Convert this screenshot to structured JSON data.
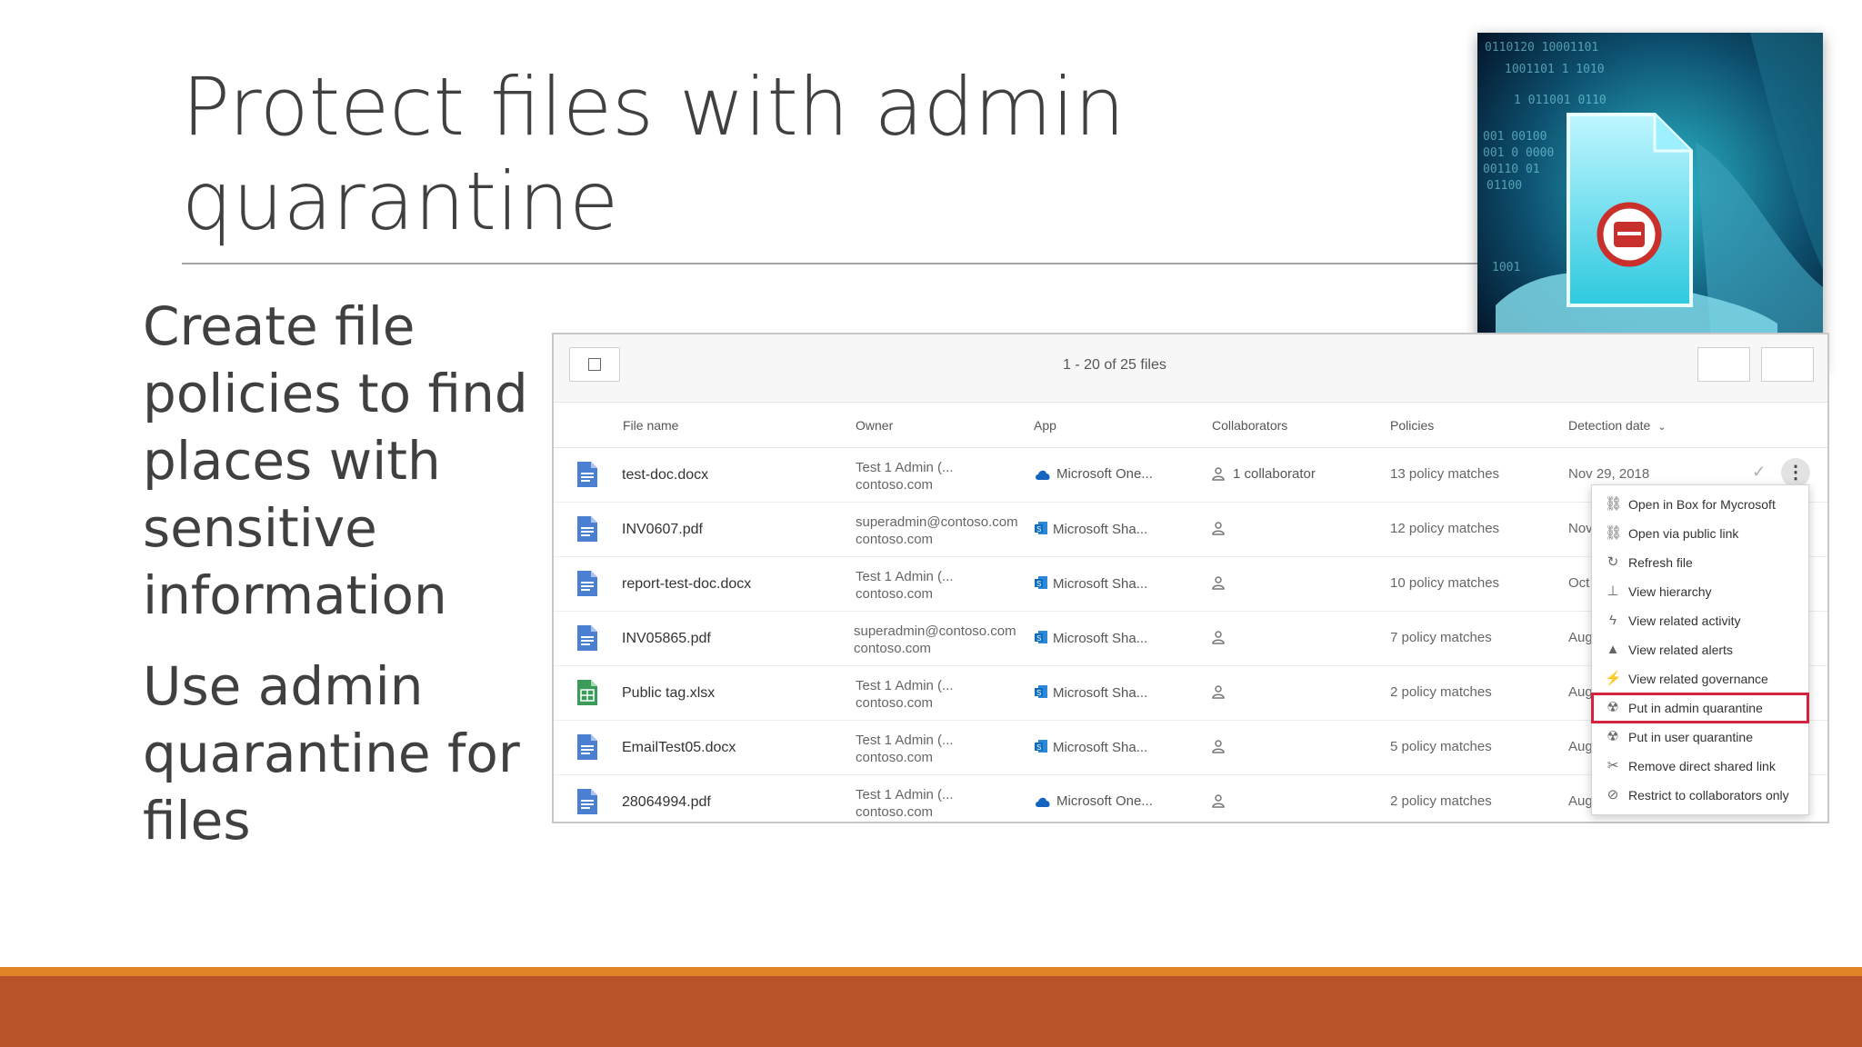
{
  "slide": {
    "title": "Protect files with admin quarantine",
    "bullets": [
      "Create file policies to find places with sensitive information",
      "Use admin quarantine for files"
    ]
  },
  "colors": {
    "accent_orange": "#e08428",
    "footer_rust": "#b8542a",
    "highlight_red": "#d3233d",
    "file_blue": "#4a7fd1",
    "file_green": "#3b9b5b"
  },
  "file_list": {
    "count_text": "1 - 20 of 25 files",
    "columns": [
      "File name",
      "Owner",
      "App",
      "Collaborators",
      "Policies",
      "Detection date"
    ],
    "rows": [
      {
        "name": "test-doc.docx",
        "icon": "doc-file-icon",
        "owner_line1": "Test 1 Admin (...",
        "owner_line2": "contoso.com",
        "app": "Microsoft One...",
        "app_icon": "onedrive-icon",
        "collaborators": "1 collaborator",
        "policies": "13 policy matches",
        "date": "Nov 29, 2018"
      },
      {
        "name": "INV0607.pdf",
        "icon": "doc-file-icon",
        "owner_line1": "superadmin@contoso.com",
        "owner_line2": "contoso.com",
        "app": "Microsoft Sha...",
        "app_icon": "sharepoint-icon",
        "collaborators": "",
        "policies": "12 policy matches",
        "date": "Nov"
      },
      {
        "name": "report-test-doc.docx",
        "icon": "doc-file-icon",
        "owner_line1": "Test 1 Admin (...",
        "owner_line2": "contoso.com",
        "app": "Microsoft Sha...",
        "app_icon": "sharepoint-icon",
        "collaborators": "",
        "policies": "10 policy matches",
        "date": "Oct"
      },
      {
        "name": "INV05865.pdf",
        "icon": "doc-file-icon",
        "owner_line1": "superadmin@contoso.com",
        "owner_line2": "contoso.com",
        "app": "Microsoft Sha...",
        "app_icon": "sharepoint-icon",
        "collaborators": "",
        "policies": "7 policy matches",
        "date": "Aug"
      },
      {
        "name": "Public tag.xlsx",
        "icon": "sheet-file-icon",
        "owner_line1": "Test 1 Admin (...",
        "owner_line2": "contoso.com",
        "app": "Microsoft Sha...",
        "app_icon": "sharepoint-icon",
        "collaborators": "",
        "policies": "2 policy matches",
        "date": "Aug"
      },
      {
        "name": "EmailTest05.docx",
        "icon": "doc-file-icon",
        "owner_line1": "Test 1 Admin (...",
        "owner_line2": "contoso.com",
        "app": "Microsoft Sha...",
        "app_icon": "sharepoint-icon",
        "collaborators": "",
        "policies": "5 policy matches",
        "date": "Aug"
      },
      {
        "name": "28064994.pdf",
        "icon": "doc-file-icon",
        "owner_line1": "Test 1 Admin (...",
        "owner_line2": "contoso.com",
        "app": "Microsoft One...",
        "app_icon": "onedrive-icon",
        "collaborators": "",
        "policies": "2 policy matches",
        "date": "Aug"
      }
    ]
  },
  "context_menu": {
    "items": [
      {
        "label": "Open in Box for Mycrosoft",
        "icon": "link-icon",
        "glyph": "⛓"
      },
      {
        "label": "Open via public link",
        "icon": "link-icon",
        "glyph": "⛓"
      },
      {
        "label": "Refresh file",
        "icon": "refresh-icon",
        "glyph": "↻"
      },
      {
        "label": "View hierarchy",
        "icon": "hierarchy-icon",
        "glyph": "⊥"
      },
      {
        "label": "View related activity",
        "icon": "activity-icon",
        "glyph": "ϟ"
      },
      {
        "label": "View related alerts",
        "icon": "bell-icon",
        "glyph": "▲"
      },
      {
        "label": "View related governance",
        "icon": "governance-icon",
        "glyph": "⚡"
      },
      {
        "label": "Put in admin quarantine",
        "icon": "quarantine-icon",
        "glyph": "☢",
        "highlighted": true
      },
      {
        "label": "Put in user quarantine",
        "icon": "quarantine-icon",
        "glyph": "☢"
      },
      {
        "label": "Remove direct shared link",
        "icon": "unlink-icon",
        "glyph": "✂"
      },
      {
        "label": "Restrict to collaborators only",
        "icon": "restrict-icon",
        "glyph": "⊘"
      }
    ]
  }
}
